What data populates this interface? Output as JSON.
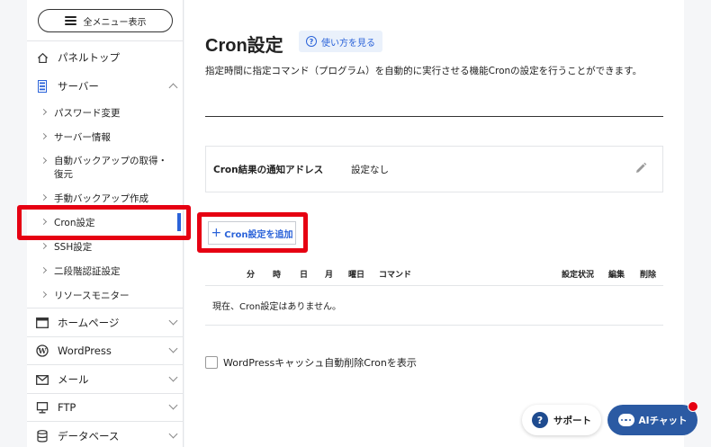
{
  "sidebar": {
    "menu_button": "全メニュー表示",
    "items": {
      "panel_top": "パネルトップ",
      "server": "サーバー",
      "homepage": "ホームページ",
      "wordpress": "WordPress",
      "mail": "メール",
      "ftp": "FTP",
      "database": "データベース"
    },
    "server_sub": [
      "パスワード変更",
      "サーバー情報",
      "自動バックアップの取得・復元",
      "手動バックアップ作成",
      "Cron設定",
      "SSH設定",
      "二段階認証設定",
      "リソースモニター"
    ],
    "active_item": "Cron設定"
  },
  "main": {
    "title": "Cron設定",
    "howto_label": "使い方を見る",
    "description": "指定時間に指定コマンド（プログラム）を自動的に実行させる機能Cronの設定を行うことができます。",
    "notify": {
      "label": "Cron結果の通知アドレス",
      "value": "設定なし"
    },
    "add_button": "Cron設定を追加",
    "table_headers": [
      "分",
      "時",
      "日",
      "月",
      "曜日",
      "コマンド",
      "設定状況",
      "編集",
      "削除"
    ],
    "empty_message": "現在、Cron設定はありません。",
    "checkbox_label": "WordPressキャッシュ自動削除Cronを表示"
  },
  "floating": {
    "support": "サポート",
    "ai_chat": "AIチャット"
  },
  "colors": {
    "accent": "#2b63d9",
    "highlight": "#e60012",
    "ai_button": "#2b5aa3"
  }
}
